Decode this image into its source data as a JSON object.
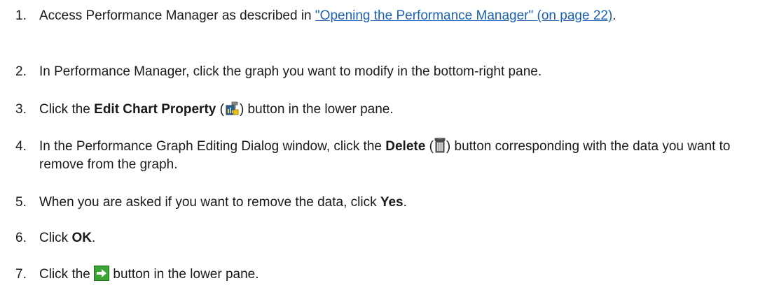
{
  "steps": [
    {
      "num": "1.",
      "pre": "Access Performance Manager as described in ",
      "link": "\"Opening the Performance Manager\" (on page 22)",
      "post": "."
    },
    {
      "num": "2.",
      "text": "In Performance Manager, click the graph you want to modify in the bottom-right pane."
    },
    {
      "num": "3.",
      "pre": "Click the ",
      "bold": "Edit Chart Property",
      "mid1": " (",
      "icon": "edit-chart-property-icon",
      "mid2": ") button in the lower pane."
    },
    {
      "num": "4.",
      "pre": "In the Performance Graph Editing Dialog window, click the ",
      "bold": "Delete",
      "mid1": " (",
      "icon": "trash-icon",
      "mid2": ") button corresponding with the data you want to remove from the graph."
    },
    {
      "num": "5.",
      "pre": "When you are asked if you want to remove the data, click ",
      "bold": "Yes",
      "post": "."
    },
    {
      "num": "6.",
      "pre": "Click ",
      "bold": "OK",
      "post": "."
    },
    {
      "num": "7.",
      "pre": "Click the ",
      "icon": "green-arrow-icon",
      "post": " button in the lower pane."
    }
  ],
  "colors": {
    "link": "#1c62b0",
    "text": "#1a1a1a",
    "arrow_green": "#3aa535"
  }
}
